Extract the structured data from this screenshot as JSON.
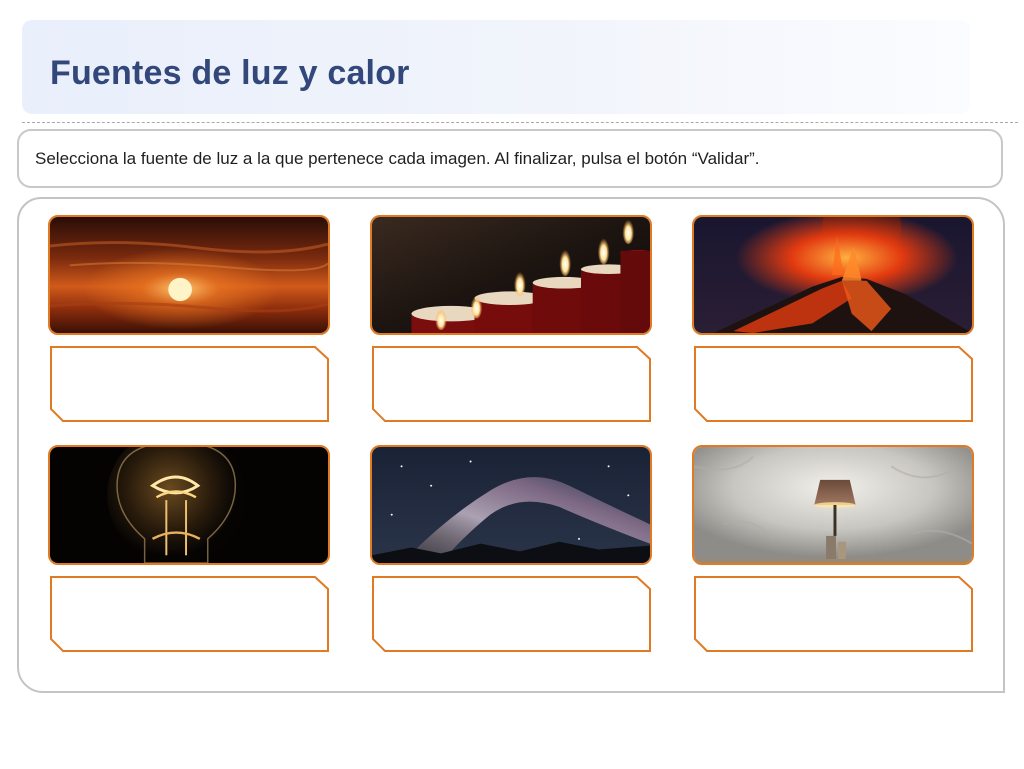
{
  "header": {
    "title": "Fuentes de luz y calor"
  },
  "instruction": {
    "text": "Selecciona la fuente de luz a la que pertenece cada imagen. Al finalizar, pulsa el botón “Validar”."
  },
  "colors": {
    "title": "#33487a",
    "card_border": "#e07b24",
    "panel_border": "#c4c4c4"
  },
  "cards": [
    {
      "image": "sunset-photo",
      "answer": ""
    },
    {
      "image": "candles-photo",
      "answer": ""
    },
    {
      "image": "volcano-photo",
      "answer": ""
    },
    {
      "image": "light-bulb-photo",
      "answer": ""
    },
    {
      "image": "milky-way-photo",
      "answer": ""
    },
    {
      "image": "table-lamp-photo",
      "answer": ""
    }
  ]
}
